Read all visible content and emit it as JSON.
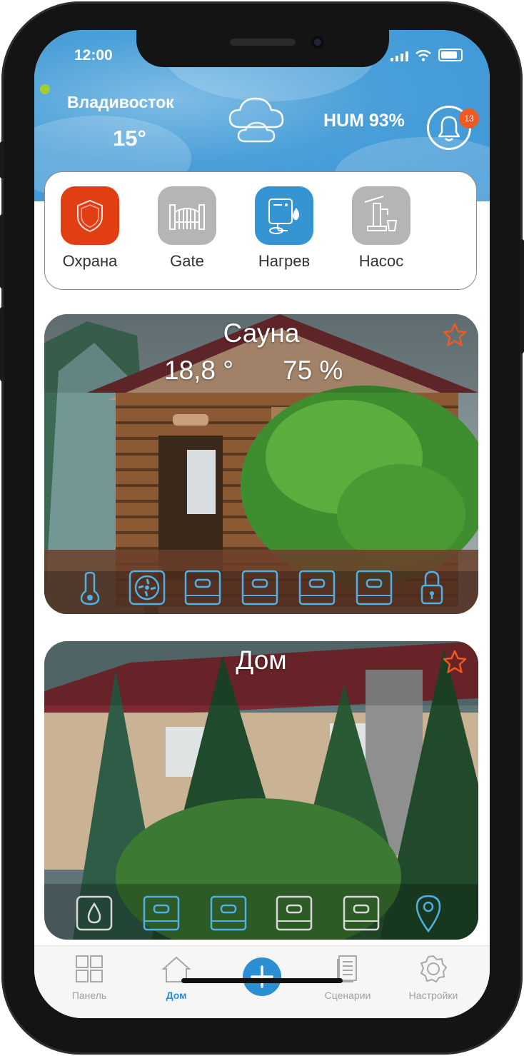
{
  "status_bar": {
    "time": "12:00"
  },
  "header": {
    "city": "Владивосток",
    "temperature": "15°",
    "weather_icon": "cloud-icon",
    "humidity": "HUM 93%",
    "notifications_count": "13",
    "accent_color": "#3b95d6"
  },
  "quick_actions": [
    {
      "label": "Охрана",
      "icon": "shield-icon",
      "color": "#e23e14"
    },
    {
      "label": "Gate",
      "icon": "gate-icon",
      "color": "#b5b5b5"
    },
    {
      "label": "Нагрев",
      "icon": "heater-icon",
      "color": "#3595d3"
    },
    {
      "label": "Насос",
      "icon": "pump-icon",
      "color": "#b5b5b5"
    }
  ],
  "cards": [
    {
      "title": "Сауна",
      "temperature": "18,8 °",
      "humidity": "75 %",
      "favorite_color": "#ef5a22",
      "devices": [
        "thermometer-icon",
        "fan-icon",
        "switch-icon",
        "switch-icon",
        "switch-icon",
        "switch-icon",
        "lock-icon"
      ]
    },
    {
      "title": "Дом",
      "favorite_color": "#ef5a22",
      "devices": [
        "water-leak-icon",
        "switch-icon",
        "switch-icon",
        "switch-icon",
        "switch-icon",
        "location-pin-icon"
      ]
    }
  ],
  "tabbar": {
    "items": [
      {
        "label": "Панель",
        "icon": "grid-icon"
      },
      {
        "label": "Дом",
        "icon": "house-icon",
        "active": true
      },
      {
        "label": "",
        "icon": "plus-icon"
      },
      {
        "label": "Сценарии",
        "icon": "document-icon"
      },
      {
        "label": "Настройки",
        "icon": "gear-icon"
      }
    ],
    "active_color": "#2c8fd3"
  }
}
